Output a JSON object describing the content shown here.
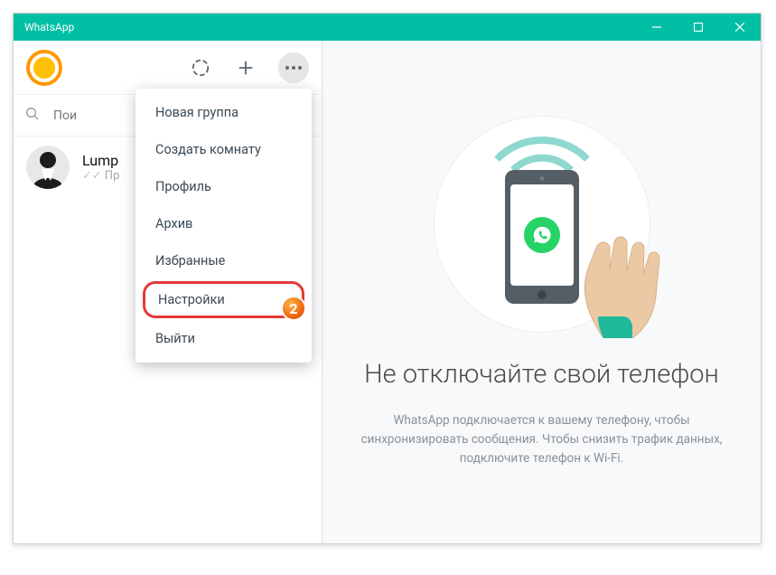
{
  "titlebar": {
    "title": "WhatsApp"
  },
  "search": {
    "placeholder": "Пои"
  },
  "chat": {
    "name": "Lump",
    "sub": "Пр"
  },
  "menu": {
    "items": [
      {
        "label": "Новая группа"
      },
      {
        "label": "Создать комнату"
      },
      {
        "label": "Профиль"
      },
      {
        "label": "Архив"
      },
      {
        "label": "Избранные"
      },
      {
        "label": "Настройки",
        "highlighted": true,
        "badge": "2"
      },
      {
        "label": "Выйти"
      }
    ]
  },
  "right": {
    "headline": "Не отключайте свой телефон",
    "subtext": "WhatsApp подключается к вашему телефону, чтобы синхронизировать сообщения. Чтобы снизить трафик данных, подключите телефон к Wi-Fi."
  }
}
